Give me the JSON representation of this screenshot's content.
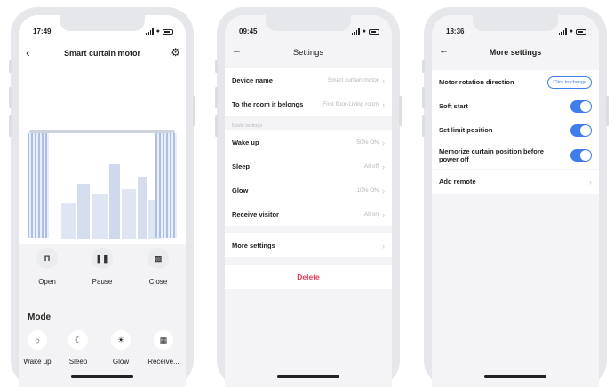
{
  "phone1": {
    "time": "17:49",
    "title": "Smart curtain motor",
    "controls": [
      {
        "label": "Open",
        "icon": "open-curtain-icon"
      },
      {
        "label": "Pause",
        "icon": "pause-icon"
      },
      {
        "label": "Close",
        "icon": "close-curtain-icon"
      }
    ],
    "mode_title": "Mode",
    "modes": [
      {
        "label": "Wake up",
        "icon": "sunrise-icon"
      },
      {
        "label": "Sleep",
        "icon": "sleep-icon"
      },
      {
        "label": "Glow",
        "icon": "glow-icon"
      },
      {
        "label": "Receive...",
        "icon": "visitor-icon"
      }
    ]
  },
  "phone2": {
    "time": "09:45",
    "title": "Settings",
    "device_name_label": "Device name",
    "device_name_value": "Smart curtain motor",
    "room_label": "To the room it belongs",
    "room_value": "First floor-Living room",
    "mode_section_label": "Mode settings",
    "modes": [
      {
        "label": "Wake up",
        "value": "50% ON"
      },
      {
        "label": "Sleep",
        "value": "All off"
      },
      {
        "label": "Glow",
        "value": "10% ON"
      },
      {
        "label": "Receive visitor",
        "value": "All on"
      }
    ],
    "more_settings": "More settings",
    "delete": "Delete"
  },
  "phone3": {
    "time": "18:36",
    "title": "More settings",
    "motor_direction_label": "Motor rotation direction",
    "change_button": "Click to change",
    "soft_start": "Soft start",
    "limit_position": "Set limit position",
    "memorize_label": "Memorize curtain position before power off",
    "add_remote": "Add remote",
    "soft_start_on": true,
    "limit_position_on": true,
    "memorize_on": true
  },
  "colors": {
    "accent": "#3f7ee8",
    "delete": "#e23d5a"
  }
}
